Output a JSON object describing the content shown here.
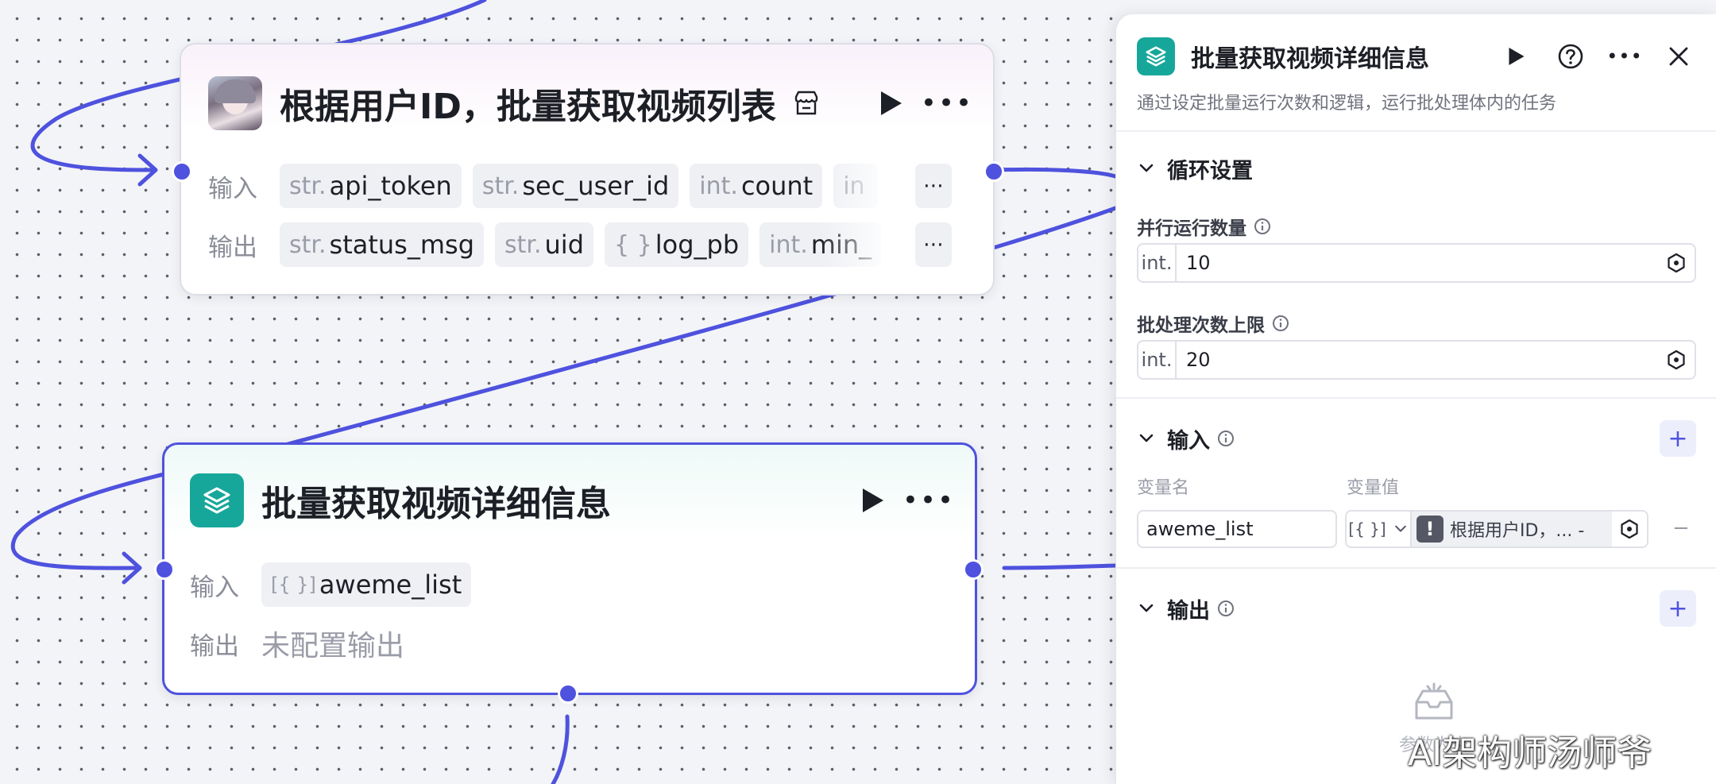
{
  "node_user_videos": {
    "title": "根据用户ID，批量获取视频列表",
    "input_label": "输入",
    "output_label": "输出",
    "inputs": [
      {
        "type": "str.",
        "name": "api_token"
      },
      {
        "type": "str.",
        "name": "sec_user_id"
      },
      {
        "type": "int.",
        "name": "count"
      },
      {
        "type": "in",
        "name": ""
      }
    ],
    "outputs": [
      {
        "type": "str.",
        "name": "status_msg"
      },
      {
        "type": "str.",
        "name": "uid"
      },
      {
        "type": "{ }",
        "name": "log_pb"
      },
      {
        "type": "int.",
        "name": "min_"
      }
    ],
    "more": "⋯"
  },
  "node_batch": {
    "title": "批量获取视频详细信息",
    "input_label": "输入",
    "output_label": "输出",
    "input_tag": {
      "type": "[{ }]",
      "name": "aweme_list"
    },
    "output_placeholder": "未配置输出"
  },
  "panel": {
    "title": "批量获取视频详细信息",
    "description": "通过设定批量运行次数和逻辑，运行批处理体内的任务",
    "loop_section": "循环设置",
    "parallel_label": "并行运行数量",
    "parallel_type": "int.",
    "parallel_value": "10",
    "limit_label": "批处理次数上限",
    "limit_type": "int.",
    "limit_value": "20",
    "input_section": "输入",
    "col_name": "变量名",
    "col_value": "变量值",
    "var_name": "aweme_list",
    "var_type": "[{ }]",
    "var_ref": "根据用户ID，... -",
    "minus": "−",
    "plus": "+",
    "output_section": "输出",
    "empty_text": "参数为空"
  },
  "watermark": "AI架构师汤师爷",
  "colors": {
    "accent": "#4e52de",
    "teal": "#17a79a"
  }
}
